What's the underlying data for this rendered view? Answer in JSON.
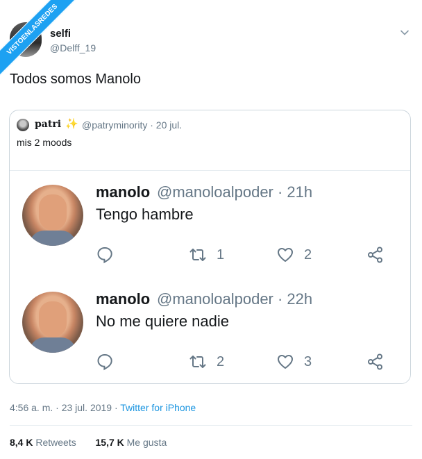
{
  "watermark": {
    "text": "VISTOENLASREDES"
  },
  "tweet": {
    "author_name": "selfi",
    "author_handle": "@Delff_19",
    "text": "Todos somos Manolo",
    "timestamp": "4:56 a. m. · 23 jul. 2019 · ",
    "source": "Twitter for iPhone",
    "retweets_count": "8,4 K",
    "retweets_label": "Retweets",
    "likes_count": "15,7 K",
    "likes_label": "Me gusta"
  },
  "quote": {
    "name": "patri",
    "emoji": "✨",
    "meta": "@patryminority · 20 jul.",
    "text": "mis 2 moods",
    "inner_tweets": [
      {
        "name": "manolo",
        "handle_time": "@manoloalpoder · 21h",
        "text": "Tengo hambre",
        "retweets": "1",
        "likes": "2"
      },
      {
        "name": "manolo",
        "handle_time": "@manoloalpoder · 22h",
        "text": "No me quiere nadie",
        "retweets": "2",
        "likes": "3"
      }
    ]
  },
  "colors": {
    "accent": "#1da1f2",
    "link": "#1b95e0",
    "muted": "#657786",
    "border": "#ccd6dd"
  },
  "icons": [
    "chevron-down-icon",
    "reply-icon",
    "retweet-icon",
    "like-icon",
    "share-icon"
  ]
}
